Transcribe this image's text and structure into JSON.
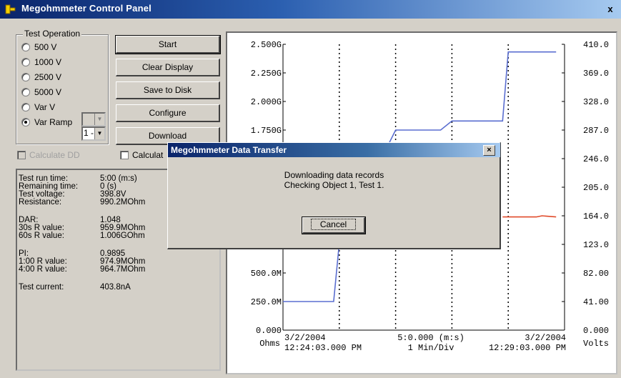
{
  "window": {
    "title": "Megohmmeter Control Panel",
    "close_glyph": "x",
    "icon": "app-plug-icon"
  },
  "test_operation": {
    "legend": "Test Operation",
    "options": [
      {
        "label": "500 V",
        "selected": false
      },
      {
        "label": "1000 V",
        "selected": false
      },
      {
        "label": "2500 V",
        "selected": false
      },
      {
        "label": "5000 V",
        "selected": false
      },
      {
        "label": "Var V",
        "selected": false
      },
      {
        "label": "Var Ramp",
        "selected": true
      }
    ],
    "var_v_combo_value": "",
    "var_ramp_combo_value": "1 -"
  },
  "buttons": {
    "start": "Start",
    "clear_display": "Clear Display",
    "save_to_disk": "Save to Disk",
    "configure": "Configure",
    "download": "Download"
  },
  "checkboxes": {
    "calculate_dd": "Calculate DD",
    "calculate_2": "Calculat"
  },
  "results": {
    "groups": [
      [
        {
          "label": "Test run time:",
          "value": "5:00 (m:s)"
        },
        {
          "label": "Remaining time:",
          "value": "0 (s)"
        },
        {
          "label": "Test voltage:",
          "value": "398.8V"
        },
        {
          "label": "Resistance:",
          "value": "990.2MOhm"
        }
      ],
      [
        {
          "label": "DAR:",
          "value": "1.048"
        },
        {
          "label": "30s R value:",
          "value": "959.9MOhm"
        },
        {
          "label": "60s R value:",
          "value": "1.006GOhm"
        }
      ],
      [
        {
          "label": "PI:",
          "value": "0.9895"
        },
        {
          "label": "1:00 R value:",
          "value": "974.9MOhm"
        },
        {
          "label": "4:00 R value:",
          "value": "964.7MOhm"
        }
      ],
      [
        {
          "label": "Test current:",
          "value": "403.8nA"
        }
      ]
    ]
  },
  "chart_data": {
    "type": "line",
    "left_axis_ticks": [
      "2.500G",
      "2.250G",
      "2.000G",
      "1.750G",
      "500.0M",
      "250.0M",
      "0.000"
    ],
    "right_axis_ticks": [
      "410.0",
      "369.0",
      "328.0",
      "287.0",
      "246.0",
      "205.0",
      "164.0",
      "123.0",
      "82.00",
      "41.00",
      "0.000"
    ],
    "left_axis_unit": "Ohms",
    "right_axis_unit": "Volts",
    "x_start": {
      "date": "3/2/2004",
      "time": "12:24:03.000 PM"
    },
    "x_center": {
      "span": "5:0.000 (m:s)",
      "scale": "1 Min/Div"
    },
    "x_end": {
      "date": "3/2/2004",
      "time": "12:29:03.000 PM"
    },
    "ylim_left": [
      0,
      2.5
    ],
    "ylim_right": [
      0,
      410
    ],
    "xlim": [
      0,
      5
    ],
    "grid": "vertical dotted lines every minute",
    "series": [
      {
        "axis": "right",
        "color": "#5a6ed0",
        "points": [
          [
            0,
            41
          ],
          [
            0.9,
            41
          ],
          [
            1.0,
            125
          ],
          [
            2.0,
            287
          ],
          [
            2.8,
            287
          ],
          [
            3.0,
            300
          ],
          [
            3.9,
            300
          ],
          [
            4.0,
            399
          ],
          [
            4.85,
            399
          ]
        ]
      },
      {
        "axis": "left",
        "color": "#e04a2a",
        "points": [
          [
            3.9,
            0.99
          ],
          [
            4.5,
            0.99
          ],
          [
            4.6,
            1.0
          ],
          [
            4.85,
            0.99
          ]
        ]
      }
    ]
  },
  "dialog": {
    "title": "Megohmmeter Data Transfer",
    "close_glyph": "×",
    "line1": "Downloading data records",
    "line2": "Checking Object 1, Test 1.",
    "cancel_label": "Cancel"
  },
  "colors": {
    "titlebar": "#0a246a",
    "face": "#d4d0c8",
    "voltage_line": "#5a6ed0",
    "resistance_line": "#e04a2a",
    "ohms_label": "#e04a2a",
    "volts_label": "#3050b0"
  }
}
